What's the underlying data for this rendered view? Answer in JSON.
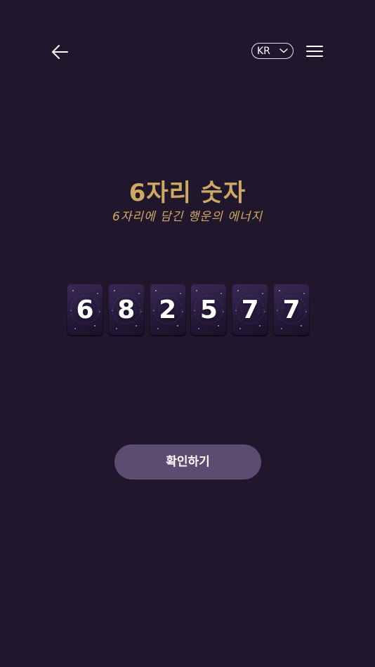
{
  "header": {
    "language_label": "KR"
  },
  "title": "6자리 숫자",
  "subtitle": "6자리에 담긴 행운의 에너지",
  "numbers": [
    "6",
    "8",
    "2",
    "5",
    "7",
    "7"
  ],
  "confirm_label": "확인하기",
  "colors": {
    "background": "#21172d",
    "accent_gold": "#cfa964",
    "button": "#5d4c72",
    "card": "#2c2040"
  }
}
